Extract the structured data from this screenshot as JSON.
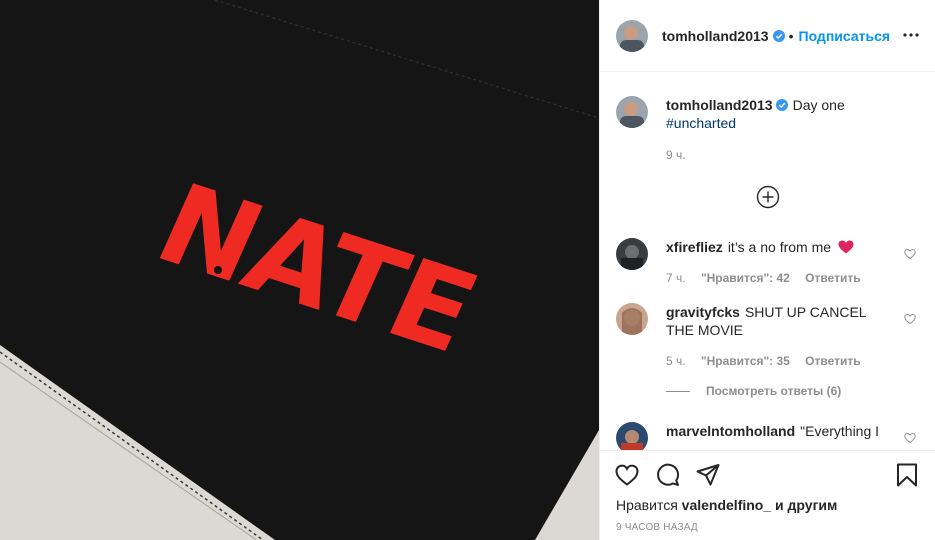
{
  "post": {
    "author": "tomholland2013",
    "follow_label": "Подписаться",
    "separator": "•",
    "image_text": "NATE"
  },
  "caption": {
    "username": "tomholland2013",
    "text": "Day one",
    "hashtag": "#uncharted",
    "time": "9 ч."
  },
  "comments": [
    {
      "username": "xfirefliez",
      "text": "it’s a no from me",
      "emoji": "heart",
      "time": "7 ч.",
      "likes": "\"Нравится\": 42",
      "reply": "Ответить"
    },
    {
      "username": "gravityfcks",
      "text": "SHUT UP CANCEL THE MOVIE",
      "time": "5 ч.",
      "likes": "\"Нравится\": 35",
      "reply": "Ответить",
      "view_replies": "Посмотреть ответы (6)"
    },
    {
      "username": "marvelntomholland",
      "text": "\"Everything I"
    }
  ],
  "footer": {
    "liked_by_prefix": "Нравится",
    "liked_by_user": "valendelfino_",
    "liked_by_suffix": "и другим",
    "timestamp": "9 часов назад"
  },
  "icons": {
    "like": "heart-outline-icon",
    "comment": "comment-bubble-icon",
    "share": "paper-plane-icon",
    "save": "bookmark-icon",
    "more": "more-dots-icon",
    "load_more": "plus-circle-icon",
    "verified": "verified-badge-icon"
  },
  "colors": {
    "link_blue": "#0095f6",
    "verified_blue": "#3897f0",
    "hashtag_blue": "#00376b",
    "secondary_text": "#8e8e8e",
    "image_red": "#ee2a22",
    "image_fabric": "#151515",
    "heart_red": "#ed4956"
  }
}
